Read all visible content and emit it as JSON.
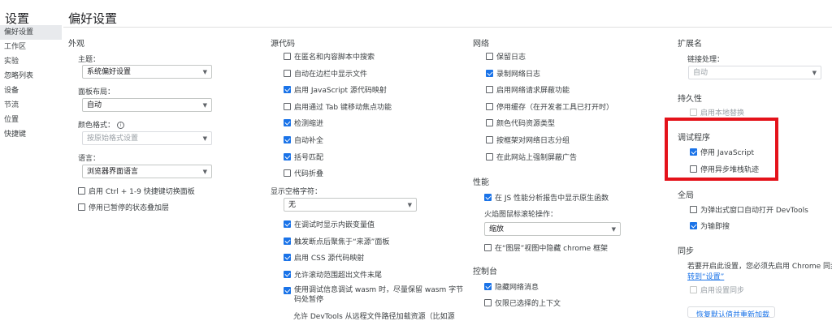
{
  "sidebar": {
    "title": "设置",
    "items": [
      {
        "label": "偏好设置",
        "active": true
      },
      {
        "label": "工作区"
      },
      {
        "label": "实验"
      },
      {
        "label": "忽略列表"
      },
      {
        "label": "设备"
      },
      {
        "label": "节流"
      },
      {
        "label": "位置"
      },
      {
        "label": "快捷键"
      }
    ]
  },
  "page_title": "偏好设置",
  "col1": {
    "section": "外观",
    "theme_label": "主题：",
    "theme_value": "系统偏好设置",
    "panel_layout_label": "面板布局：",
    "panel_layout_value": "自动",
    "color_format_label": "颜色格式：",
    "color_format_value": "按原始格式设置",
    "language_label": "语言：",
    "language_value": "浏览器界面语言",
    "cb_ctrl19": "启用 Ctrl + 1-9 快捷键切换面板",
    "cb_paused_overlay": "停用已暂停的状态叠加层"
  },
  "col2": {
    "section": "源代码",
    "items": [
      {
        "label": "在匿名和内容脚本中搜索",
        "checked": false
      },
      {
        "label": "自动在边栏中显示文件",
        "checked": false
      },
      {
        "label": "启用 JavaScript 源代码映射",
        "checked": true
      },
      {
        "label": "启用通过 Tab 键移动焦点功能",
        "checked": false
      },
      {
        "label": "检测缩进",
        "checked": true
      },
      {
        "label": "自动补全",
        "checked": true
      },
      {
        "label": "括号匹配",
        "checked": true
      },
      {
        "label": "代码折叠",
        "checked": false
      }
    ],
    "whitespace_label": "显示空格字符：",
    "whitespace_value": "无",
    "items2": [
      {
        "label": "在调试时显示内嵌变量值",
        "checked": true
      },
      {
        "label": "触发断点后聚焦于“来源”面板",
        "checked": true
      },
      {
        "label": "启用 CSS 源代码映射",
        "checked": true
      },
      {
        "label": "允许滚动范围超出文件末尾",
        "checked": true
      }
    ],
    "wasm_line1": "使用调试信息调试 wasm 时，尽量保留 wasm 字节",
    "wasm_line2": "码处暂停",
    "cut_off": "允许 DevTools 从远程文件路径加载资源（比如源"
  },
  "col3": {
    "section": "网络",
    "items": [
      {
        "label": "保留日志",
        "checked": false
      },
      {
        "label": "录制网络日志",
        "checked": true
      },
      {
        "label": "启用网络请求屏蔽功能",
        "checked": false
      },
      {
        "label": "停用缓存（在开发者工具已打开时）",
        "checked": false
      },
      {
        "label": "颜色代码资源类型",
        "checked": false
      },
      {
        "label": "按框架对网络日志分组",
        "checked": false
      },
      {
        "label": "在此网站上强制屏蔽广告",
        "checked": false
      }
    ],
    "perf_section": "性能",
    "perf_cb": "在 JS 性能分析报告中显示原生函数",
    "flame_label": "火焰图鼠标滚轮操作：",
    "flame_value": "缩放",
    "layers_cb": "在“图层”视图中隐藏 chrome 框架",
    "console_section": "控制台",
    "console_items": [
      {
        "label": "隐藏网络消息",
        "checked": true
      },
      {
        "label": "仅限已选择的上下文",
        "checked": false
      }
    ]
  },
  "col4": {
    "ext_section": "扩展名",
    "link_label": "链接处理：",
    "link_value": "自动",
    "persist_section": "持久性",
    "persist_cb": "启用本地替换",
    "debugger_section": "调试程序",
    "debugger_items": [
      {
        "label": "停用 JavaScript",
        "checked": true
      },
      {
        "label": "停用异步堆栈轨迹",
        "checked": false
      }
    ],
    "global_section": "全局",
    "global_items": [
      {
        "label": "为弹出式窗口自动打开 DevTools",
        "checked": false
      },
      {
        "label": "为输即搜",
        "checked": true
      }
    ],
    "sync_section": "同步",
    "sync_text": "若要开启此设置，您必须先启用 Chrome 同步。",
    "sync_link": "转到“设置”",
    "sync_cb": "启用设置同步",
    "reset_button": "恢复默认值并重新加载"
  }
}
